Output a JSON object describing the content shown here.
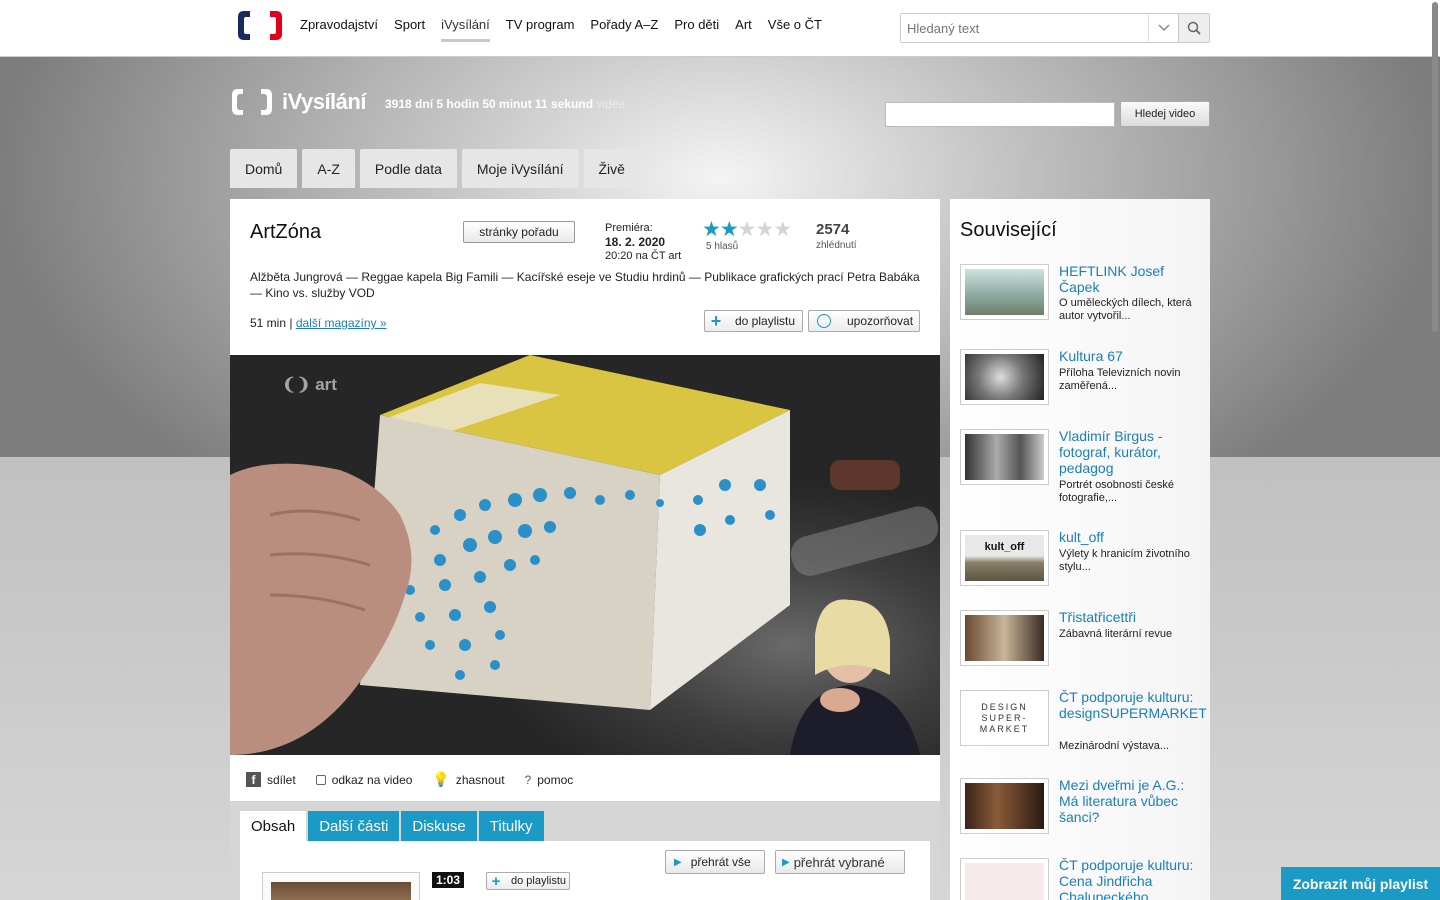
{
  "header": {
    "nav": [
      "Zpravodajství",
      "Sport",
      "iVysílání",
      "TV program",
      "Pořady A–Z",
      "Pro děti",
      "Art",
      "Vše o ČT"
    ],
    "search_placeholder": "Hledaný text"
  },
  "ivysilani": {
    "brand": "iVysílání",
    "counter": "3918 dní 5 hodin 50 minut 11 sekund",
    "counter_suffix": "videa",
    "search_button": "Hledej video",
    "menu": [
      "Domů",
      "A-Z",
      "Podle data",
      "Moje iVysílání",
      "Živě"
    ]
  },
  "show": {
    "title": "ArtZóna",
    "pages_button": "stránky pořadu",
    "premiere_label": "Premiéra:",
    "premiere_date": "18. 2. 2020",
    "premiere_time": "20:20 na ČT art",
    "rating_stars": 2,
    "rating_votes": "5 hlasů",
    "views": "2574",
    "views_label": "zhlédnutí",
    "topics": "Alžběta Jungrová — Reggae kapela Big Famili — Kacířské eseje ve Studiu hrdinů — Publikace grafických prací Petra Babáka — Kino vs. služby VOD",
    "duration": "51 min |",
    "more_link": "další magazíny »",
    "playlist_button": "do playlistu",
    "alert_button": "upozorňovat",
    "video_watermark": "art"
  },
  "share": {
    "share": "sdílet",
    "link": "odkaz na video",
    "dim": "zhasnout",
    "help": "pomoc"
  },
  "tabs": [
    "Obsah",
    "Další části",
    "Diskuse",
    "Titulky"
  ],
  "episode": {
    "duration": "1:03",
    "playlist_button": "do playlistu",
    "play_all": "přehrát vše",
    "play_selected": "přehrát vybrané"
  },
  "related": {
    "title": "Související",
    "items": [
      {
        "title": "HEFTLINK Josef Čapek",
        "desc": "O uměleckých dílech, která autor vytvořil..."
      },
      {
        "title": "Kultura 67",
        "desc": "Příloha Televizních novin zaměřená..."
      },
      {
        "title": "Vladimír Birgus - fotograf, kurátor, pedagog",
        "desc": "Portrét osobnosti české fotografie,..."
      },
      {
        "title": "kult_off",
        "desc": "Výlety k hranicím životního stylu...",
        "thumb_text": "kult_off"
      },
      {
        "title": "Třistatřicettři",
        "desc": "Zábavná literární revue"
      },
      {
        "title": "ČT podporuje kulturu: designSUPERMARKET",
        "desc": "Mezinárodní výstava...",
        "thumb_text": "DESIGN SUPER- MARKET"
      },
      {
        "title": "Mezi dveřmi je A.G.: Má literatura vůbec šanci?",
        "desc": ""
      },
      {
        "title": "ČT podporuje kulturu: Cena Jindřicha Chalupeckého",
        "desc": ""
      }
    ]
  },
  "playlist_button": "Zobrazit můj playlist",
  "colors": {
    "accent": "#1a9ac4",
    "link": "#1a7fb8"
  }
}
